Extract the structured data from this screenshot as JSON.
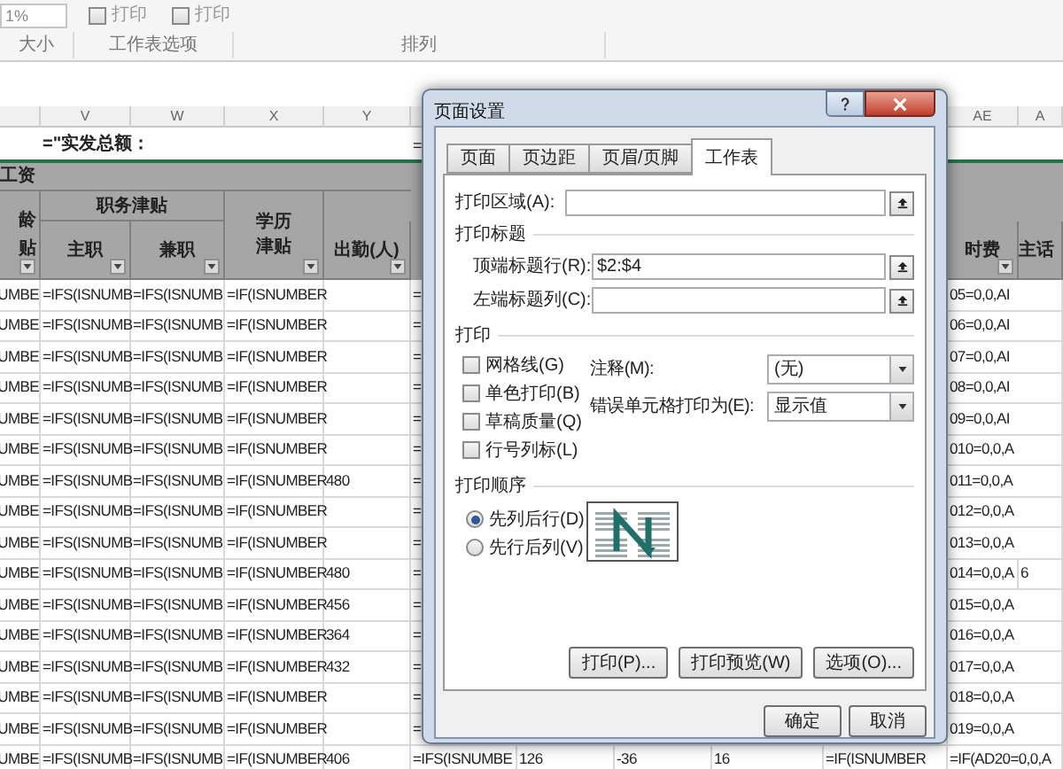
{
  "ribbon": {
    "zoom_field": "1%",
    "checkboxes": [
      {
        "label": "打印",
        "checked": false
      },
      {
        "label": "打印",
        "checked": false
      }
    ],
    "groups": [
      "大小",
      "工作表选项",
      "排列"
    ]
  },
  "sheet": {
    "column_headers_left": [
      "V",
      "W",
      "X",
      "Y"
    ],
    "column_headers_right": [
      "AE",
      "A"
    ],
    "row_1": {
      "formula": "=\"实发总额：",
      "right": "="
    },
    "header": {
      "group": "工资",
      "left": "龄贴",
      "allowance": "职务津贴",
      "main": "主职",
      "part_time": "兼职",
      "education": "学历津贴",
      "attendance": "出勤(人)",
      "column_ae": "时费",
      "column_af": "主话"
    },
    "rows": [
      [
        "UMBE",
        "=IFS(ISNUMB",
        "=IFS(ISNUMB",
        "=IF(ISNUMBER",
        null,
        "=",
        null,
        null,
        null,
        null,
        "05=0,0,AI",
        null
      ],
      [
        "UMBE",
        "=IFS(ISNUMB",
        "=IFS(ISNUMB",
        "=IF(ISNUMBER",
        null,
        "=",
        null,
        null,
        null,
        null,
        "06=0,0,AI",
        null
      ],
      [
        "UMBE",
        "=IFS(ISNUMB",
        "=IFS(ISNUMB",
        "=IF(ISNUMBER",
        null,
        "=",
        null,
        null,
        null,
        null,
        "07=0,0,AI",
        null
      ],
      [
        "UMBE",
        "=IFS(ISNUMB",
        "=IFS(ISNUMB",
        "=IF(ISNUMBER",
        null,
        "=",
        null,
        null,
        null,
        null,
        "08=0,0,AI",
        null
      ],
      [
        "UMBE",
        "=IFS(ISNUMB",
        "=IFS(ISNUMB",
        "=IF(ISNUMBER",
        null,
        "=",
        null,
        null,
        null,
        null,
        "09=0,0,AI",
        null
      ],
      [
        "UMBE",
        "=IFS(ISNUMB",
        "=IFS(ISNUMB",
        "=IF(ISNUMBER",
        null,
        "=",
        null,
        null,
        null,
        null,
        "010=0,0,A",
        null
      ],
      [
        "UMBE",
        "=IFS(ISNUMB",
        "=IFS(ISNUMB",
        "=IF(ISNUMBER",
        "480",
        "=",
        null,
        null,
        null,
        null,
        "011=0,0,A",
        null
      ],
      [
        "UMBE",
        "=IFS(ISNUMB",
        "=IFS(ISNUMB",
        "=IF(ISNUMBER",
        null,
        "=",
        null,
        null,
        null,
        null,
        "012=0,0,A",
        null
      ],
      [
        "UMBE",
        "=IFS(ISNUMB",
        "=IFS(ISNUMB",
        "=IF(ISNUMBER",
        null,
        "=",
        null,
        null,
        null,
        null,
        "013=0,0,A",
        null
      ],
      [
        "UMBE",
        "=IFS(ISNUMB",
        "=IFS(ISNUMB",
        "=IF(ISNUMBER",
        "480",
        "=",
        null,
        null,
        null,
        null,
        "014=0,0,A",
        "6"
      ],
      [
        "UMBE",
        "=IFS(ISNUMB",
        "=IFS(ISNUMB",
        "=IF(ISNUMBER",
        "456",
        "=",
        null,
        null,
        null,
        null,
        "015=0,0,A",
        null
      ],
      [
        "UMBE",
        "=IFS(ISNUMB",
        "=IFS(ISNUMB",
        "=IF(ISNUMBER",
        "364",
        "=",
        null,
        null,
        null,
        null,
        "016=0,0,A",
        null
      ],
      [
        "UMBE",
        "=IFS(ISNUMB",
        "=IFS(ISNUMB",
        "=IF(ISNUMBER",
        "432",
        "=",
        null,
        null,
        null,
        null,
        "017=0,0,A",
        null
      ],
      [
        "UMBE",
        "=IFS(ISNUMB",
        "=IFS(ISNUMB",
        "=IF(ISNUMBER",
        null,
        "=",
        null,
        null,
        null,
        null,
        "018=0,0,A",
        null
      ],
      [
        "UMBE",
        "=IFS(ISNUMB",
        "=IFS(ISNUMB",
        "=IF(ISNUMBER",
        null,
        "=",
        null,
        null,
        null,
        null,
        "019=0,0,A",
        null
      ],
      [
        "UMBE",
        "=IFS(ISNUMB",
        "=IFS(ISNUMB",
        "=IF(ISNUMBER",
        "406",
        "=IFS(ISNUMBE",
        "126",
        "-36",
        "16",
        "=IF(ISNUMBER",
        "=IF(AD20=0,0,A",
        null
      ]
    ]
  },
  "dialog": {
    "title": "页面设置",
    "tabs": [
      {
        "label": "页面",
        "selected": false
      },
      {
        "label": "页边距",
        "selected": false
      },
      {
        "label": "页眉/页脚",
        "selected": false
      },
      {
        "label": "工作表",
        "selected": true
      }
    ],
    "print_area": {
      "label": "打印区域(A):"
    },
    "print_titles": {
      "heading": "打印标题",
      "fields": [
        {
          "label": "顶端标题行(R):",
          "value": "$2:$4"
        },
        {
          "label": "左端标题列(C):"
        }
      ]
    },
    "print": {
      "heading": "打印",
      "options": [
        {
          "label": "网格线(G)",
          "checked": false
        },
        {
          "label": "单色打印(B)",
          "checked": false
        },
        {
          "label": "草稿质量(Q)",
          "checked": false
        },
        {
          "label": "行号列标(L)",
          "checked": false
        }
      ],
      "selects": [
        {
          "label": "注释(M):",
          "value": "(无)"
        },
        {
          "label": "错误单元格打印为(E):",
          "value": "显示值"
        }
      ]
    },
    "page_order": {
      "heading": "打印顺序",
      "options": [
        {
          "label": "先列后行(D)",
          "selected": true
        },
        {
          "label": "先行后列(V)",
          "selected": false
        }
      ]
    },
    "panel_buttons": [
      "打印(P)...",
      "打印预览(W)",
      "选项(O)..."
    ],
    "buttons": [
      "确定",
      "取消"
    ]
  }
}
